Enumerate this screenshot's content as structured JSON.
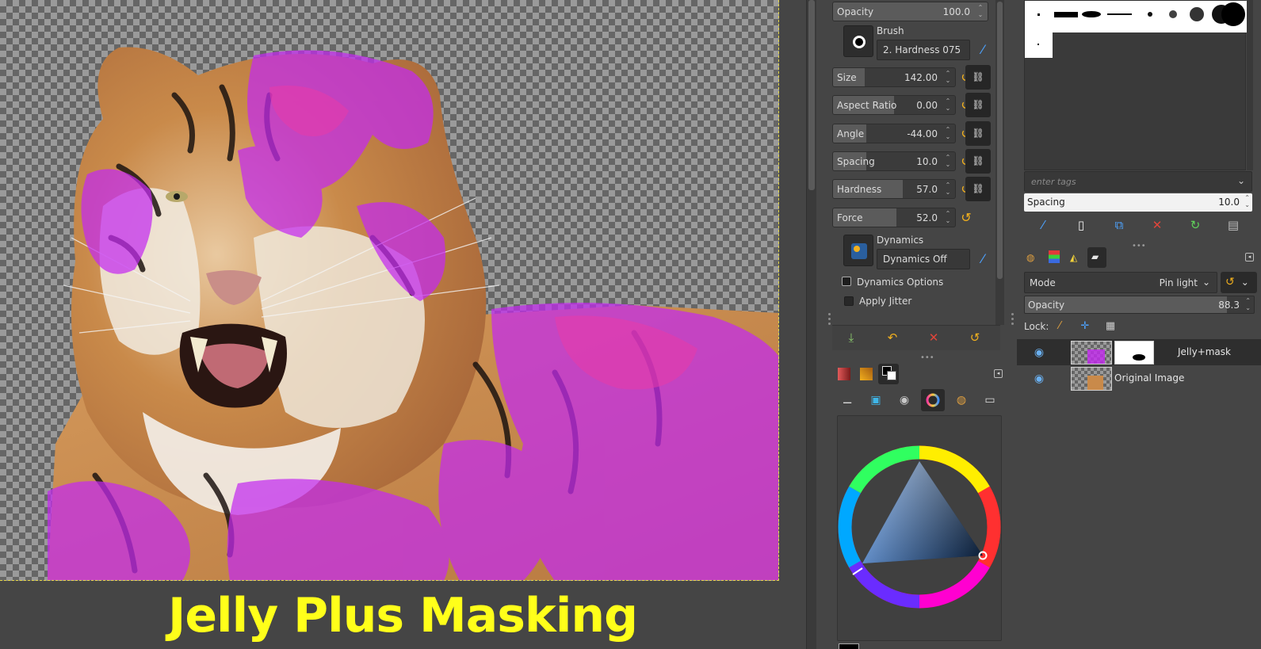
{
  "caption": "Jelly Plus Masking",
  "tool_options": {
    "opacity": {
      "label": "Opacity",
      "value": "100.0",
      "fraction": 1.0
    },
    "brush": {
      "label": "Brush",
      "name": "2. Hardness 075"
    },
    "size": {
      "label": "Size",
      "value": "142.00",
      "fraction": 0.17
    },
    "aspect_ratio": {
      "label": "Aspect Ratio",
      "value": "0.00",
      "fraction": 0.5
    },
    "angle": {
      "label": "Angle",
      "value": "-44.00",
      "fraction": 0.26
    },
    "spacing": {
      "label": "Spacing",
      "value": "10.0",
      "fraction": 0.26
    },
    "hardness": {
      "label": "Hardness",
      "value": "57.0",
      "fraction": 0.57
    },
    "force": {
      "label": "Force",
      "value": "52.0",
      "fraction": 0.52
    },
    "dynamics": {
      "label": "Dynamics",
      "name": "Dynamics Off"
    },
    "dynamics_options_label": "Dynamics Options",
    "apply_jitter_label": "Apply Jitter"
  },
  "brushes": {
    "tags_placeholder": "enter tags",
    "spacing": {
      "label": "Spacing",
      "value": "10.0"
    }
  },
  "layers": {
    "mode": {
      "label": "Mode",
      "value": "Pin light"
    },
    "opacity": {
      "label": "Opacity",
      "value": "88.3",
      "fraction": 0.883
    },
    "lock_label": "Lock:",
    "items": [
      {
        "name": "Jelly+mask",
        "selected": true
      },
      {
        "name": "Original Image",
        "selected": false
      }
    ]
  },
  "colors": {
    "accent": "#f2b01e",
    "link": "#4da3ff",
    "caption_color": "#ffff1a",
    "foreground": "#000000",
    "background": "#ffffff"
  },
  "icons": [
    "brush-icon",
    "new-icon",
    "duplicate-icon",
    "delete-icon",
    "refresh-icon",
    "open-icon",
    "eye-icon",
    "chain-icon",
    "reset-icon",
    "wheel-icon"
  ]
}
